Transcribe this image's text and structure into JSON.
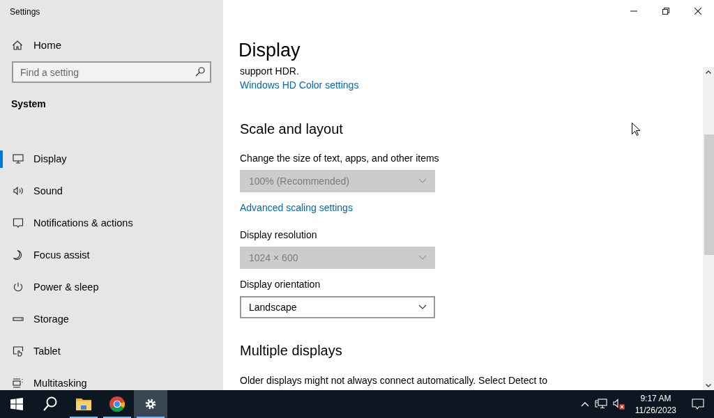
{
  "window": {
    "title": "Settings"
  },
  "sidebar": {
    "home": "Home",
    "search": {
      "placeholder": "Find a setting"
    },
    "section": "System",
    "items": [
      {
        "label": "Display",
        "selected": true
      },
      {
        "label": "Sound",
        "selected": false
      },
      {
        "label": "Notifications & actions",
        "selected": false
      },
      {
        "label": "Focus assist",
        "selected": false
      },
      {
        "label": "Power & sleep",
        "selected": false
      },
      {
        "label": "Storage",
        "selected": false
      },
      {
        "label": "Tablet",
        "selected": false
      },
      {
        "label": "Multitasking",
        "selected": false
      }
    ]
  },
  "page": {
    "title": "Display",
    "blocks": [
      {
        "kind": "text",
        "text": "support HDR."
      },
      {
        "kind": "link",
        "text": "Windows HD Color settings"
      },
      {
        "kind": "heading",
        "text": "Scale and layout"
      },
      {
        "kind": "dropdown",
        "label": "Change the size of text, apps, and other items",
        "value": "100% (Recommended)",
        "disabled": true
      },
      {
        "kind": "link",
        "text": "Advanced scaling settings"
      },
      {
        "kind": "dropdown",
        "label": "Display resolution",
        "value": "1024 × 600",
        "disabled": true
      },
      {
        "kind": "dropdown",
        "label": "Display orientation",
        "value": "Landscape",
        "disabled": false
      },
      {
        "kind": "heading",
        "text": "Multiple displays"
      },
      {
        "kind": "text",
        "text": "Older displays might not always connect automatically. Select Detect to"
      }
    ]
  },
  "taskbar": {
    "apps": [
      {
        "running": false,
        "selected": false
      },
      {
        "running": true,
        "selected": false
      },
      {
        "running": true,
        "selected": false
      },
      {
        "running": true,
        "selected": true
      }
    ],
    "tray": {
      "time": "9:17 AM",
      "date": "11/26/2023"
    }
  }
}
